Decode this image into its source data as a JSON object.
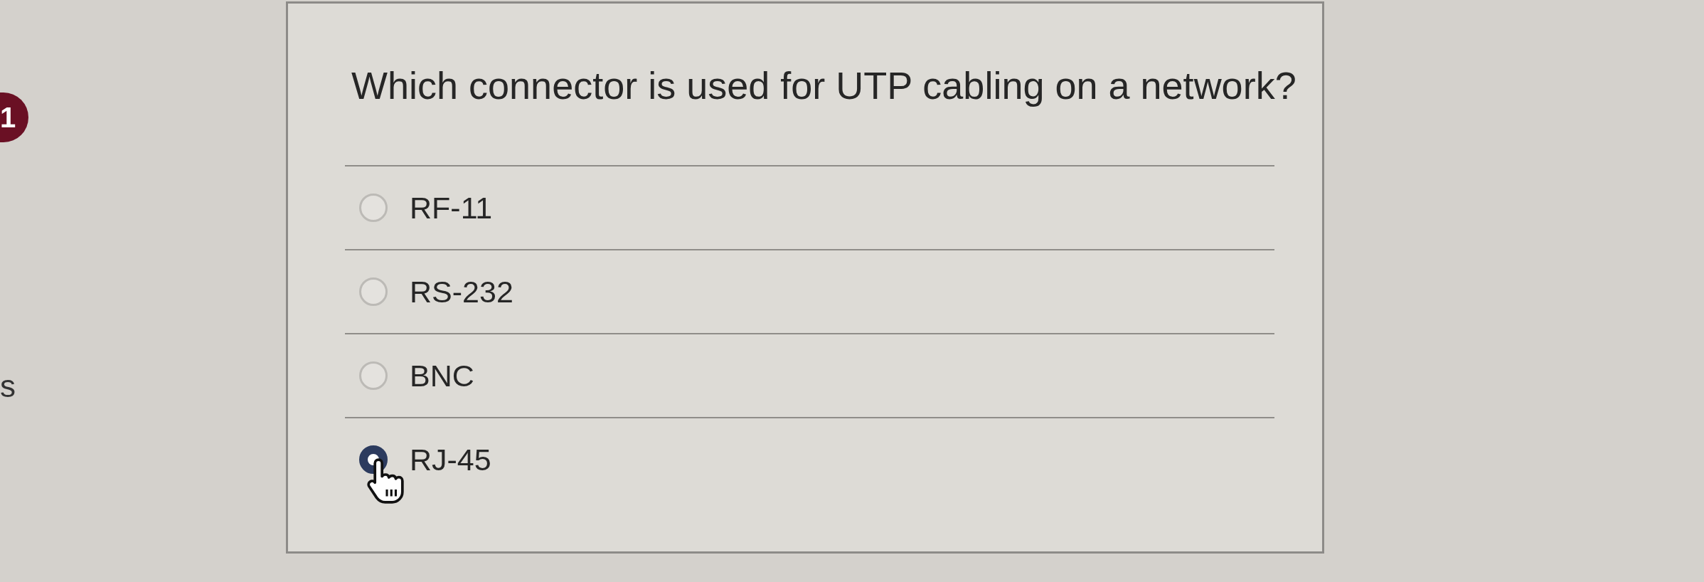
{
  "badge": {
    "label": "1"
  },
  "side_text": "s",
  "question": "Which connector is used for UTP cabling on a network?",
  "options": [
    {
      "label": "RF-11",
      "selected": false
    },
    {
      "label": "RS-232",
      "selected": false
    },
    {
      "label": "BNC",
      "selected": false
    },
    {
      "label": "RJ-45",
      "selected": true
    }
  ]
}
